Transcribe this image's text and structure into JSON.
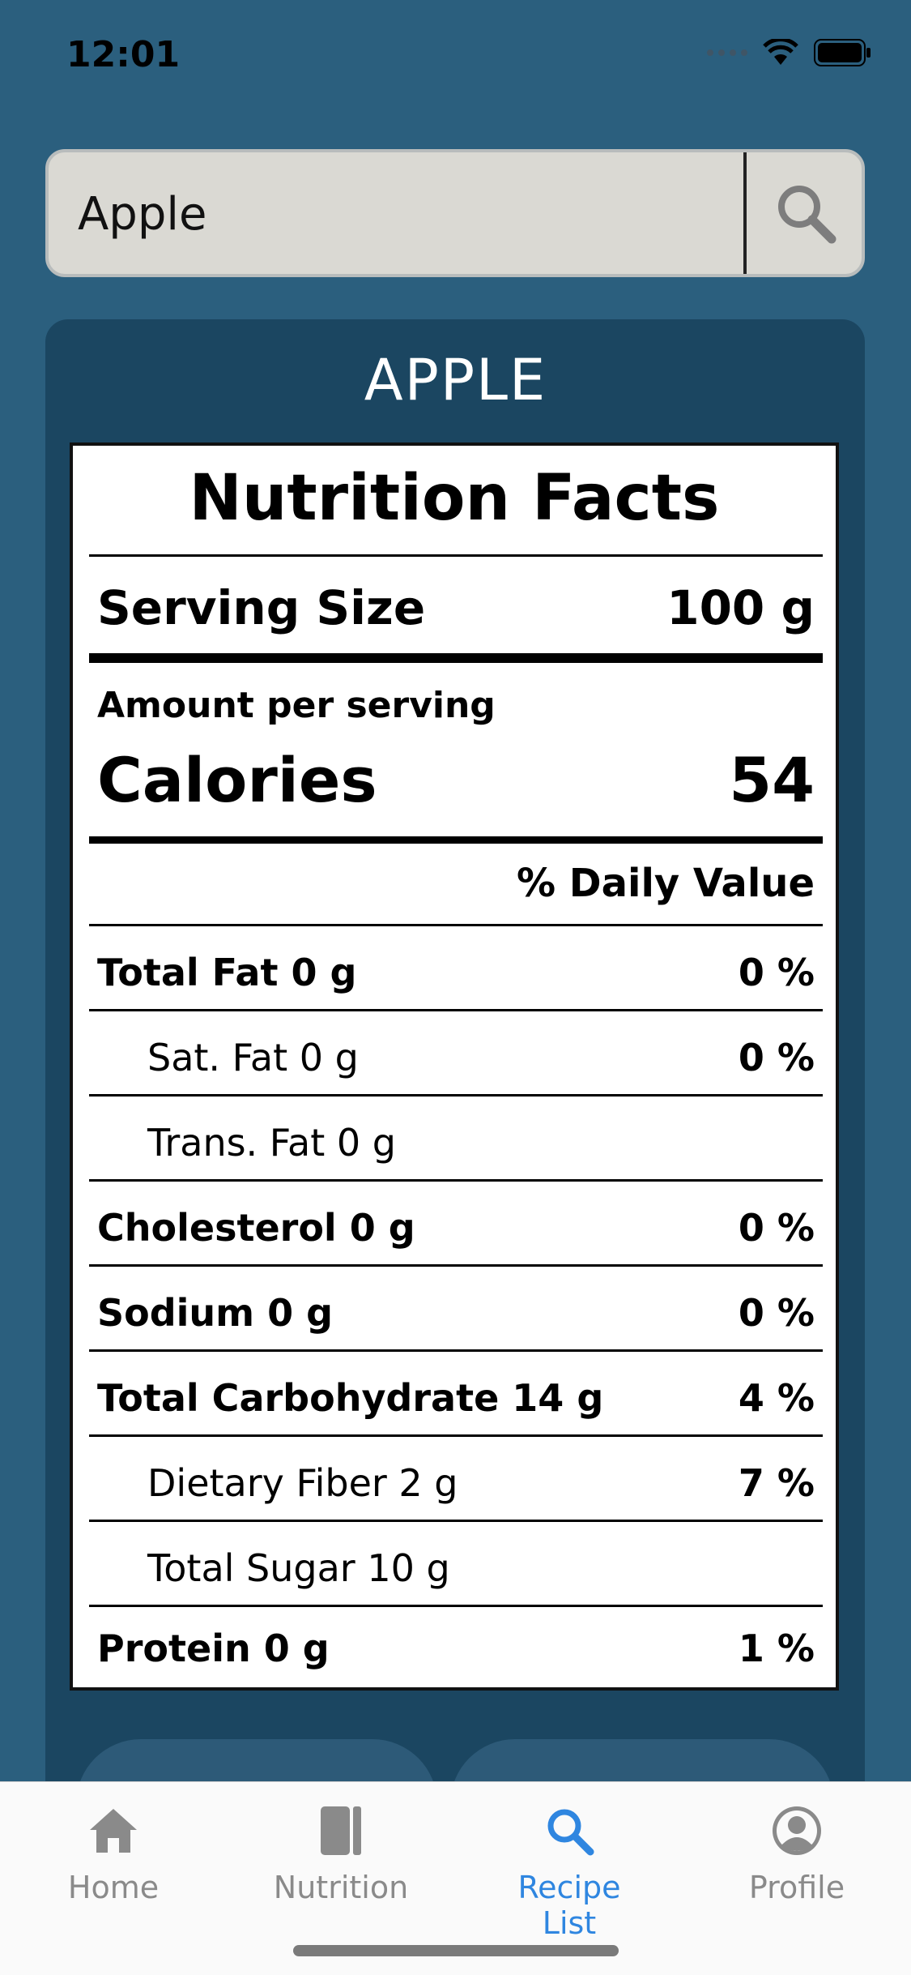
{
  "status": {
    "time": "12:01"
  },
  "search": {
    "query": "Apple"
  },
  "food": {
    "title": "APPLE"
  },
  "label": {
    "title": "Nutrition Facts",
    "serving_size_label": "Serving Size",
    "serving_size_value": "100 g",
    "amount_per_serving": "Amount per serving",
    "calories_label": "Calories",
    "calories_value": "54",
    "daily_value_header": "% Daily Value",
    "rows": [
      {
        "label": "Total Fat 0 g",
        "dv": "0 %"
      },
      {
        "label": "Sat. Fat 0 g",
        "dv": "0 %"
      },
      {
        "label": "Trans. Fat 0 g",
        "dv": ""
      },
      {
        "label": "Cholesterol 0 g",
        "dv": "0 %"
      },
      {
        "label": "Sodium 0 g",
        "dv": "0 %"
      },
      {
        "label": "Total Carbohydrate 14 g",
        "dv": "4 %"
      },
      {
        "label": "Dietary Fiber 2 g",
        "dv": "7 %"
      },
      {
        "label": "Total Sugar 10 g",
        "dv": ""
      },
      {
        "label": "Protein 0 g",
        "dv": "1 %"
      }
    ]
  },
  "tabs": [
    {
      "label": "Home",
      "icon": "home-icon",
      "active": false
    },
    {
      "label": "Nutrition",
      "icon": "book-icon",
      "active": false
    },
    {
      "label": "Recipe List",
      "icon": "search-icon",
      "active": true
    },
    {
      "label": "Profile",
      "icon": "profile-icon",
      "active": false
    }
  ],
  "colors": {
    "background": "#2b5f7e",
    "card": "#1b4661",
    "accent": "#2f86e0",
    "search_bg": "#dad9d3"
  }
}
